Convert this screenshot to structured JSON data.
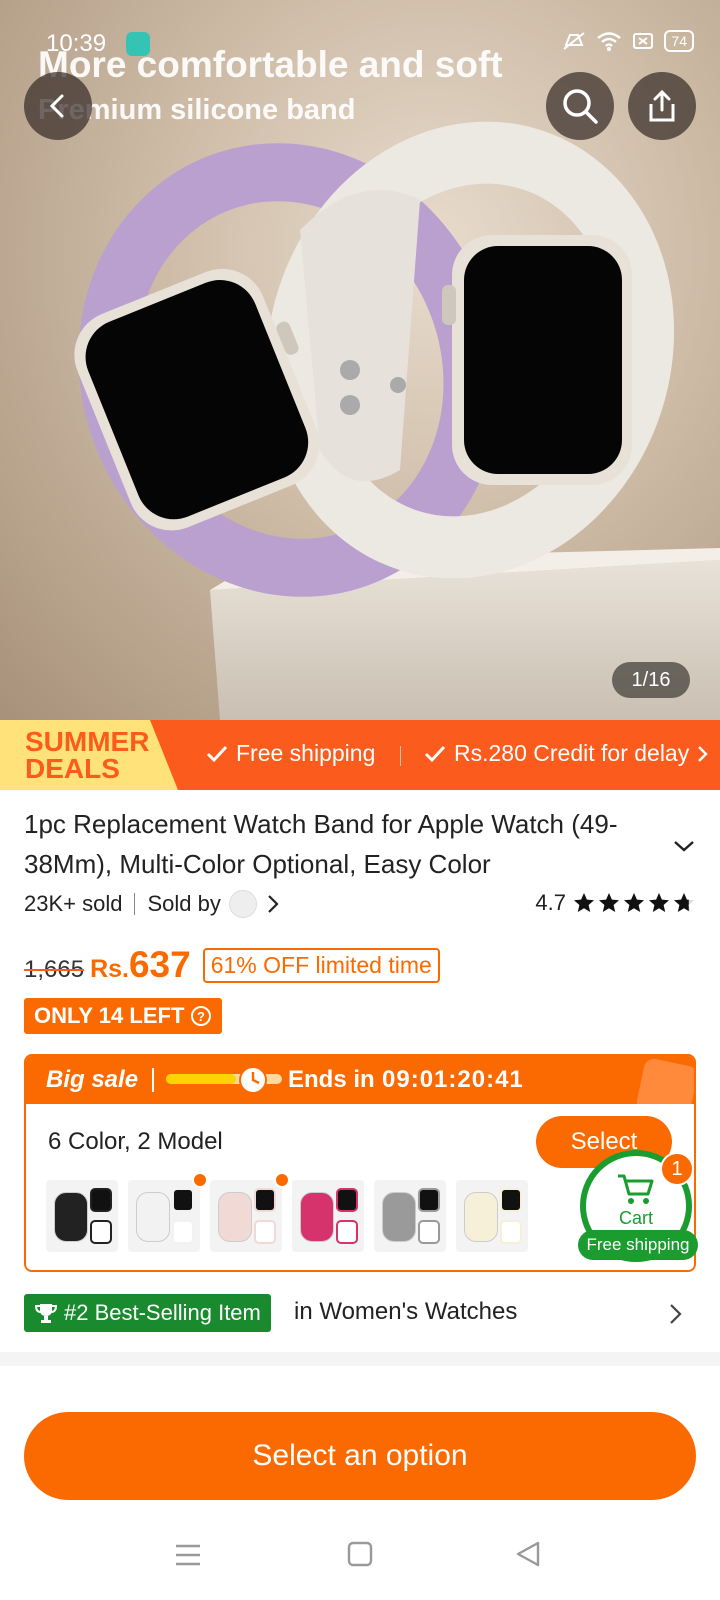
{
  "status_bar": {
    "time": "10:39",
    "battery": "74",
    "icons": [
      "mute-icon",
      "wifi-icon",
      "sim-icon",
      "battery-icon"
    ]
  },
  "hero": {
    "promo_line1": "More comfortable and soft",
    "promo_line2": "Premium silicone band",
    "image_counter": "1/16"
  },
  "deals_bar": {
    "badge_line1": "SUMMER",
    "badge_line2": "DEALS",
    "item1": "Free shipping",
    "item2": "Rs.280 Credit for delay"
  },
  "product": {
    "title": "1pc Replacement Watch Band for Apple Watch (49-38Mm), Multi-Color Optional, Easy Color",
    "sold": "23K+ sold",
    "sold_by": "Sold by",
    "rating": "4.7",
    "rating_stars": 4.7,
    "old_price": "1,665",
    "currency": "Rs.",
    "price": "637",
    "discount": "61% OFF limited time",
    "stock": "ONLY 14 LEFT"
  },
  "big_sale": {
    "label": "Big sale",
    "ends_label": "Ends in",
    "countdown": "09:01:20:41",
    "progress": 0.6
  },
  "options": {
    "summary": "6 Color, 2 Model",
    "select_label": "Select"
  },
  "swatches": [
    {
      "name": "black",
      "color": "#222222",
      "hot": false
    },
    {
      "name": "white",
      "color": "#f2f2f2",
      "hot": true
    },
    {
      "name": "pink",
      "color": "#f1d9d6",
      "hot": true
    },
    {
      "name": "magenta",
      "color": "#d6336c",
      "hot": false
    },
    {
      "name": "gray",
      "color": "#9a9a9a",
      "hot": false
    },
    {
      "name": "cream",
      "color": "#f6f0d8",
      "hot": false
    }
  ],
  "cart": {
    "label": "Cart",
    "count": "1",
    "free_shipping": "Free shipping"
  },
  "best_selling": {
    "badge": "#2 Best-Selling Item",
    "category": "in Women's Watches"
  },
  "cta": {
    "label": "Select an option"
  },
  "colors": {
    "accent": "#fb6a00",
    "deals": "#fb5b1c",
    "green": "#1a8a2f"
  }
}
